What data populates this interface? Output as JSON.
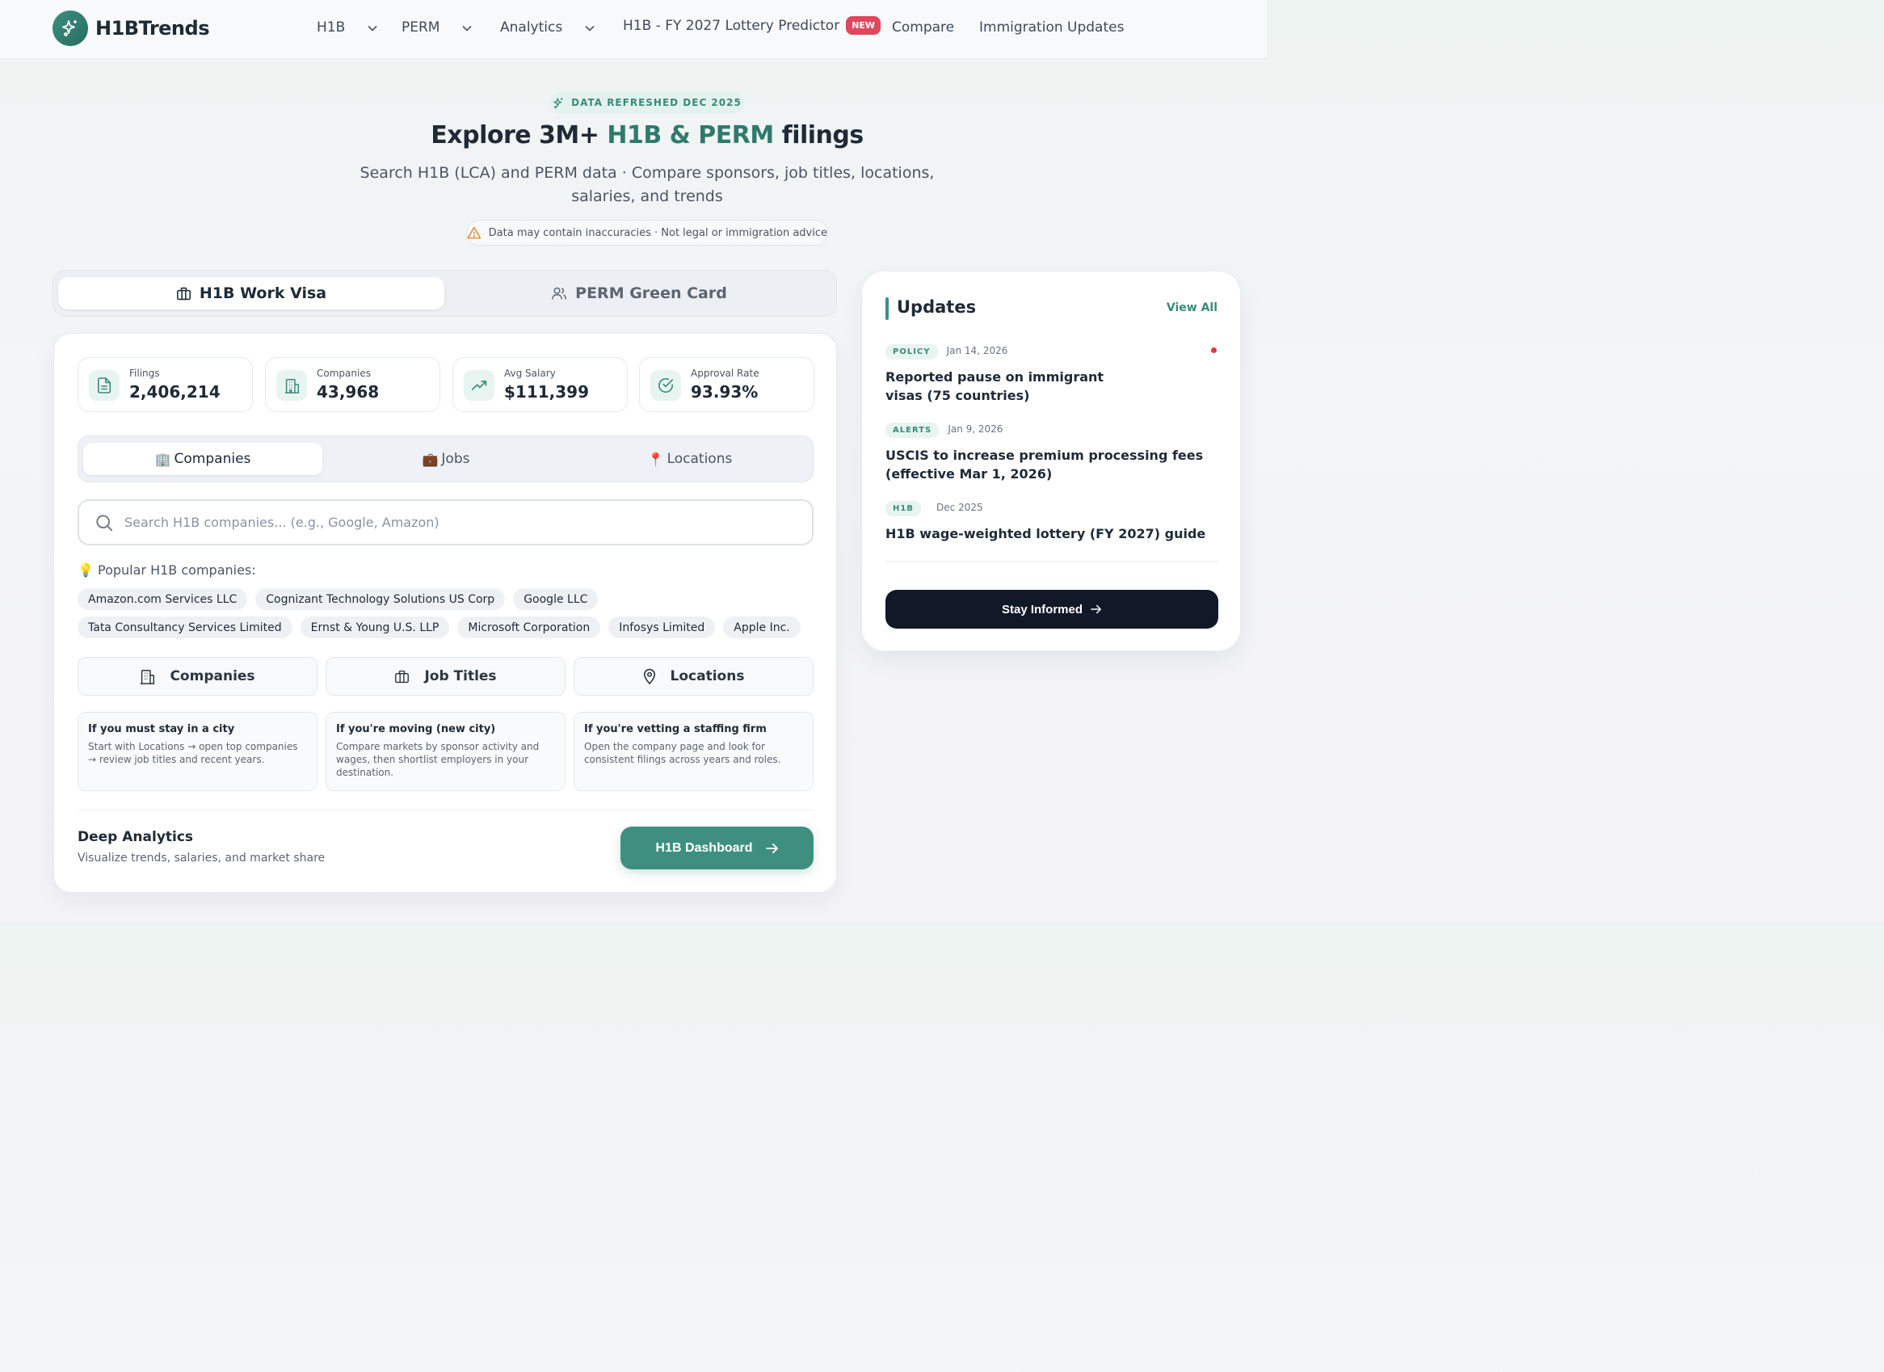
{
  "nav": {
    "logo_text": "H1BTrends",
    "items": [
      {
        "label": "H1B",
        "has_dropdown": true
      },
      {
        "label": "PERM",
        "has_dropdown": true
      },
      {
        "label": "Analytics",
        "has_dropdown": true
      },
      {
        "label": "H1B - FY 2027 Lottery Predictor",
        "badge": "NEW"
      },
      {
        "label": "Compare"
      },
      {
        "label": "Immigration Updates"
      }
    ]
  },
  "hero": {
    "pill": "DATA REFRESHED DEC 2025",
    "title_prefix": "Explore 3M+ ",
    "title_accent": "H1B & PERM",
    "title_suffix": " filings",
    "subtitle": "Search H1B (LCA) and PERM data · Compare sponsors, job titles, locations, salaries, and trends",
    "warning": "Data may contain inaccuracies · Not legal or immigration advice"
  },
  "mode_tabs": [
    {
      "label": "H1B Work Visa",
      "active": true
    },
    {
      "label": "PERM Green Card",
      "active": false
    }
  ],
  "stats": [
    {
      "label": "Filings",
      "value": "2,406,214",
      "icon": "document-icon"
    },
    {
      "label": "Companies",
      "value": "43,968",
      "icon": "building-icon"
    },
    {
      "label": "Avg Salary",
      "value": "$111,399",
      "icon": "trend-up-icon"
    },
    {
      "label": "Approval Rate",
      "value": "93.93%",
      "icon": "check-circle-icon"
    }
  ],
  "category_tabs": [
    {
      "emoji": "🏢",
      "label": "Companies",
      "active": true
    },
    {
      "emoji": "💼",
      "label": "Jobs",
      "active": false
    },
    {
      "emoji": "📍",
      "label": "Locations",
      "active": false
    }
  ],
  "search": {
    "placeholder": "Search H1B companies... (e.g., Google, Amazon)",
    "value": ""
  },
  "popular": {
    "label": "💡 Popular H1B companies:",
    "row1": [
      "Amazon.com Services LLC",
      "Cognizant Technology Solutions US Corp",
      "Google LLC"
    ],
    "row2": [
      "Tata Consultancy Services Limited",
      "Ernst & Young U.S. LLP",
      "Microsoft Corporation",
      "Infosys Limited",
      "Apple Inc."
    ]
  },
  "quick_links": [
    {
      "label": "Companies",
      "icon": "building-icon"
    },
    {
      "label": "Job Titles",
      "icon": "briefcase-icon"
    },
    {
      "label": "Locations",
      "icon": "map-pin-icon"
    }
  ],
  "tips": [
    {
      "title": "If you must stay in a city",
      "text": "Start with Locations → open top companies → review job titles and recent years."
    },
    {
      "title": "If you're moving (new city)",
      "text": "Compare markets by sponsor activity and wages, then shortlist employers in your destination."
    },
    {
      "title": "If you're vetting a staffing firm",
      "text": "Open the company page and look for consistent filings across years and roles."
    }
  ],
  "deep": {
    "title": "Deep Analytics",
    "subtitle": "Visualize trends, salaries, and market share",
    "button": "H1B Dashboard"
  },
  "updates": {
    "title": "Updates",
    "view_all": "View All",
    "items": [
      {
        "tag": "POLICY",
        "date": "Jan 14, 2026",
        "headline": "Reported pause on immigrant visas (75 countries)",
        "unread": true
      },
      {
        "tag": "ALERTS",
        "date": "Jan 9, 2026",
        "headline": "USCIS to increase premium processing fees (effective Mar 1, 2026)",
        "unread": false
      },
      {
        "tag": "H1B",
        "date": "Dec 2025",
        "headline": "H1B wage-weighted lottery (FY 2027) guide",
        "unread": false
      }
    ],
    "button": "Stay Informed"
  },
  "colors": {
    "accent": "#3f8f80",
    "new_badge": "#e0475c",
    "dark_button": "#111827",
    "unread_dot": "#dc3b3b"
  }
}
